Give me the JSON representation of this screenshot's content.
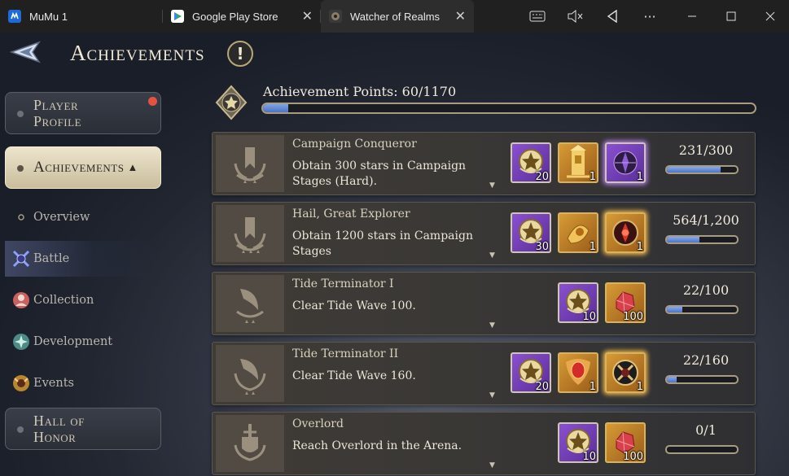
{
  "window": {
    "tabs": [
      {
        "label": "MuMu 1",
        "icon": "mumu-icon"
      },
      {
        "label": "Google Play Store",
        "icon": "play-store-icon"
      },
      {
        "label": "Watcher of Realms",
        "icon": "game-icon"
      }
    ],
    "controls": [
      "keyboard-icon",
      "mute-icon",
      "back-triangle-icon",
      "more-icon",
      "minimize-icon",
      "maximize-icon",
      "close-icon"
    ]
  },
  "header": {
    "title": "Achievements",
    "info_symbol": "!"
  },
  "sidebar": {
    "buttons": {
      "player_profile": "Player Profile",
      "achievements": "Achievements",
      "achievements_arrow": "▲",
      "hall_of_honor": "Hall of Honor"
    },
    "sub_items": [
      {
        "label": "Overview",
        "icon": "dot-icon"
      },
      {
        "label": "Battle",
        "icon": "battle-icon"
      },
      {
        "label": "Collection",
        "icon": "collection-icon"
      },
      {
        "label": "Development",
        "icon": "development-icon"
      },
      {
        "label": "Events",
        "icon": "events-icon"
      }
    ]
  },
  "points": {
    "label": "Achievement Points:",
    "value": "60/1170",
    "fraction": 0.051
  },
  "achievements": [
    {
      "title": "Campaign Conqueror",
      "description": "Obtain 300 stars in Campaign Stages (Hard).",
      "progress": "231/300",
      "fraction": 0.77,
      "rewards": [
        {
          "type": "purple",
          "icon": "star-icon",
          "count": "20"
        },
        {
          "type": "gold",
          "icon": "gold-tower-icon",
          "count": "1"
        },
        {
          "type": "purple",
          "icon": "dark-emblem-icon",
          "count": "1"
        }
      ]
    },
    {
      "title": "Hail, Great Explorer",
      "description": "Obtain 1200 stars in Campaign Stages",
      "progress": "564/1,200",
      "fraction": 0.47,
      "rewards": [
        {
          "type": "purple",
          "icon": "star-icon",
          "count": "30"
        },
        {
          "type": "gold",
          "icon": "gold-relic-icon",
          "count": "1"
        },
        {
          "type": "gold",
          "icon": "red-emblem-icon",
          "count": "1"
        }
      ]
    },
    {
      "title": "Tide Terminator I",
      "description": "Clear Tide Wave 100.",
      "progress": "22/100",
      "fraction": 0.22,
      "rewards": [
        {
          "type": "purple",
          "icon": "star-icon",
          "count": "10"
        },
        {
          "type": "gold",
          "icon": "red-gem-icon",
          "count": "100"
        }
      ]
    },
    {
      "title": "Tide Terminator II",
      "description": "Clear Tide Wave 160.",
      "progress": "22/160",
      "fraction": 0.14,
      "rewards": [
        {
          "type": "purple",
          "icon": "star-icon",
          "count": "20"
        },
        {
          "type": "gold",
          "icon": "red-amulet-icon",
          "count": "1"
        },
        {
          "type": "gold",
          "icon": "black-emblem-icon",
          "count": "1"
        }
      ]
    },
    {
      "title": "Overlord",
      "description": "Reach Overlord in the Arena.",
      "progress": "0/1",
      "fraction": 0.0,
      "rewards": [
        {
          "type": "purple",
          "icon": "star-icon",
          "count": "10"
        },
        {
          "type": "gold",
          "icon": "red-gem-icon",
          "count": "100"
        }
      ]
    }
  ]
}
